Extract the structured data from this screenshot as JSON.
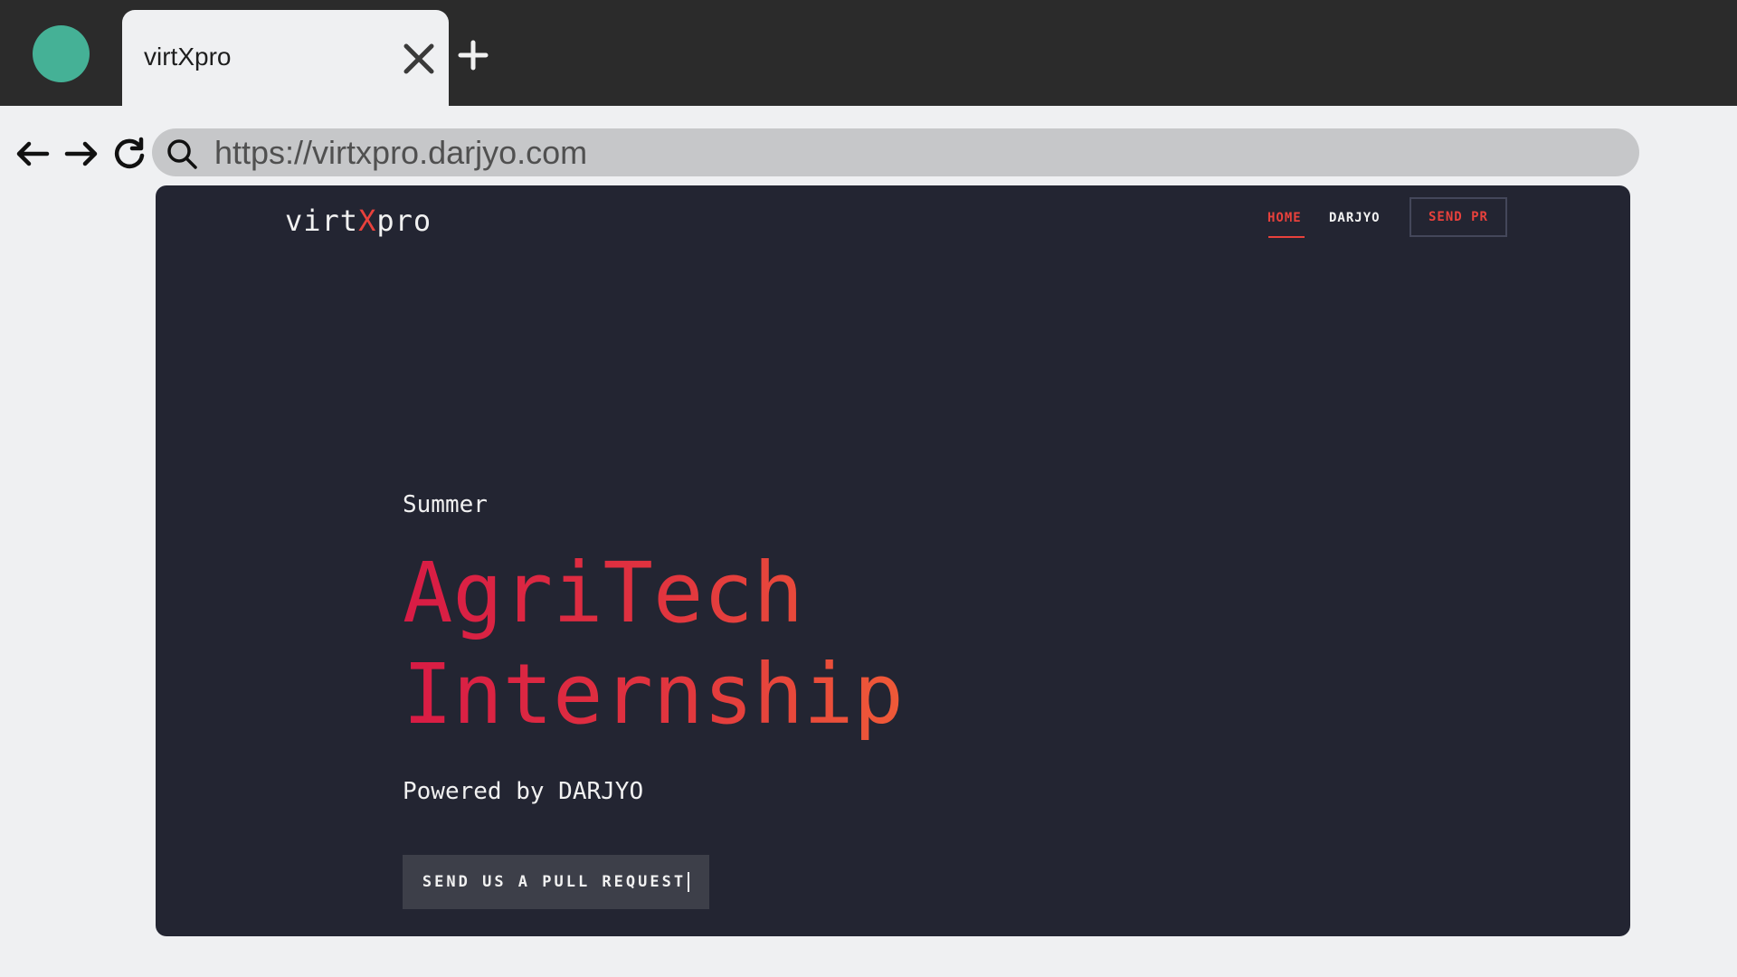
{
  "browser": {
    "tab_title": "virtXpro",
    "url": "https://virtxpro.darjyo.com",
    "icons": {
      "close": "close-icon",
      "new_tab": "plus-icon",
      "back": "arrow-left-icon",
      "forward": "arrow-right-icon",
      "reload": "reload-icon",
      "search": "search-icon"
    },
    "profile_color": "#45b196"
  },
  "site": {
    "logo": {
      "prefix": "virt",
      "accent": "X",
      "suffix": "pro"
    },
    "nav": {
      "home": "HOME",
      "darjyo": "DARJYO",
      "send_pr": "SEND PR"
    },
    "hero": {
      "subtitle": "Summer",
      "title_line1": "AgriTech",
      "title_line2": "Internship",
      "powered": "Powered by DARJYO",
      "cta": "SEND US A PULL REQUEST"
    },
    "colors": {
      "background": "#232532",
      "accent": "#e8413c",
      "gradient_start": "#d81b45",
      "gradient_end": "#ef5a38"
    }
  }
}
